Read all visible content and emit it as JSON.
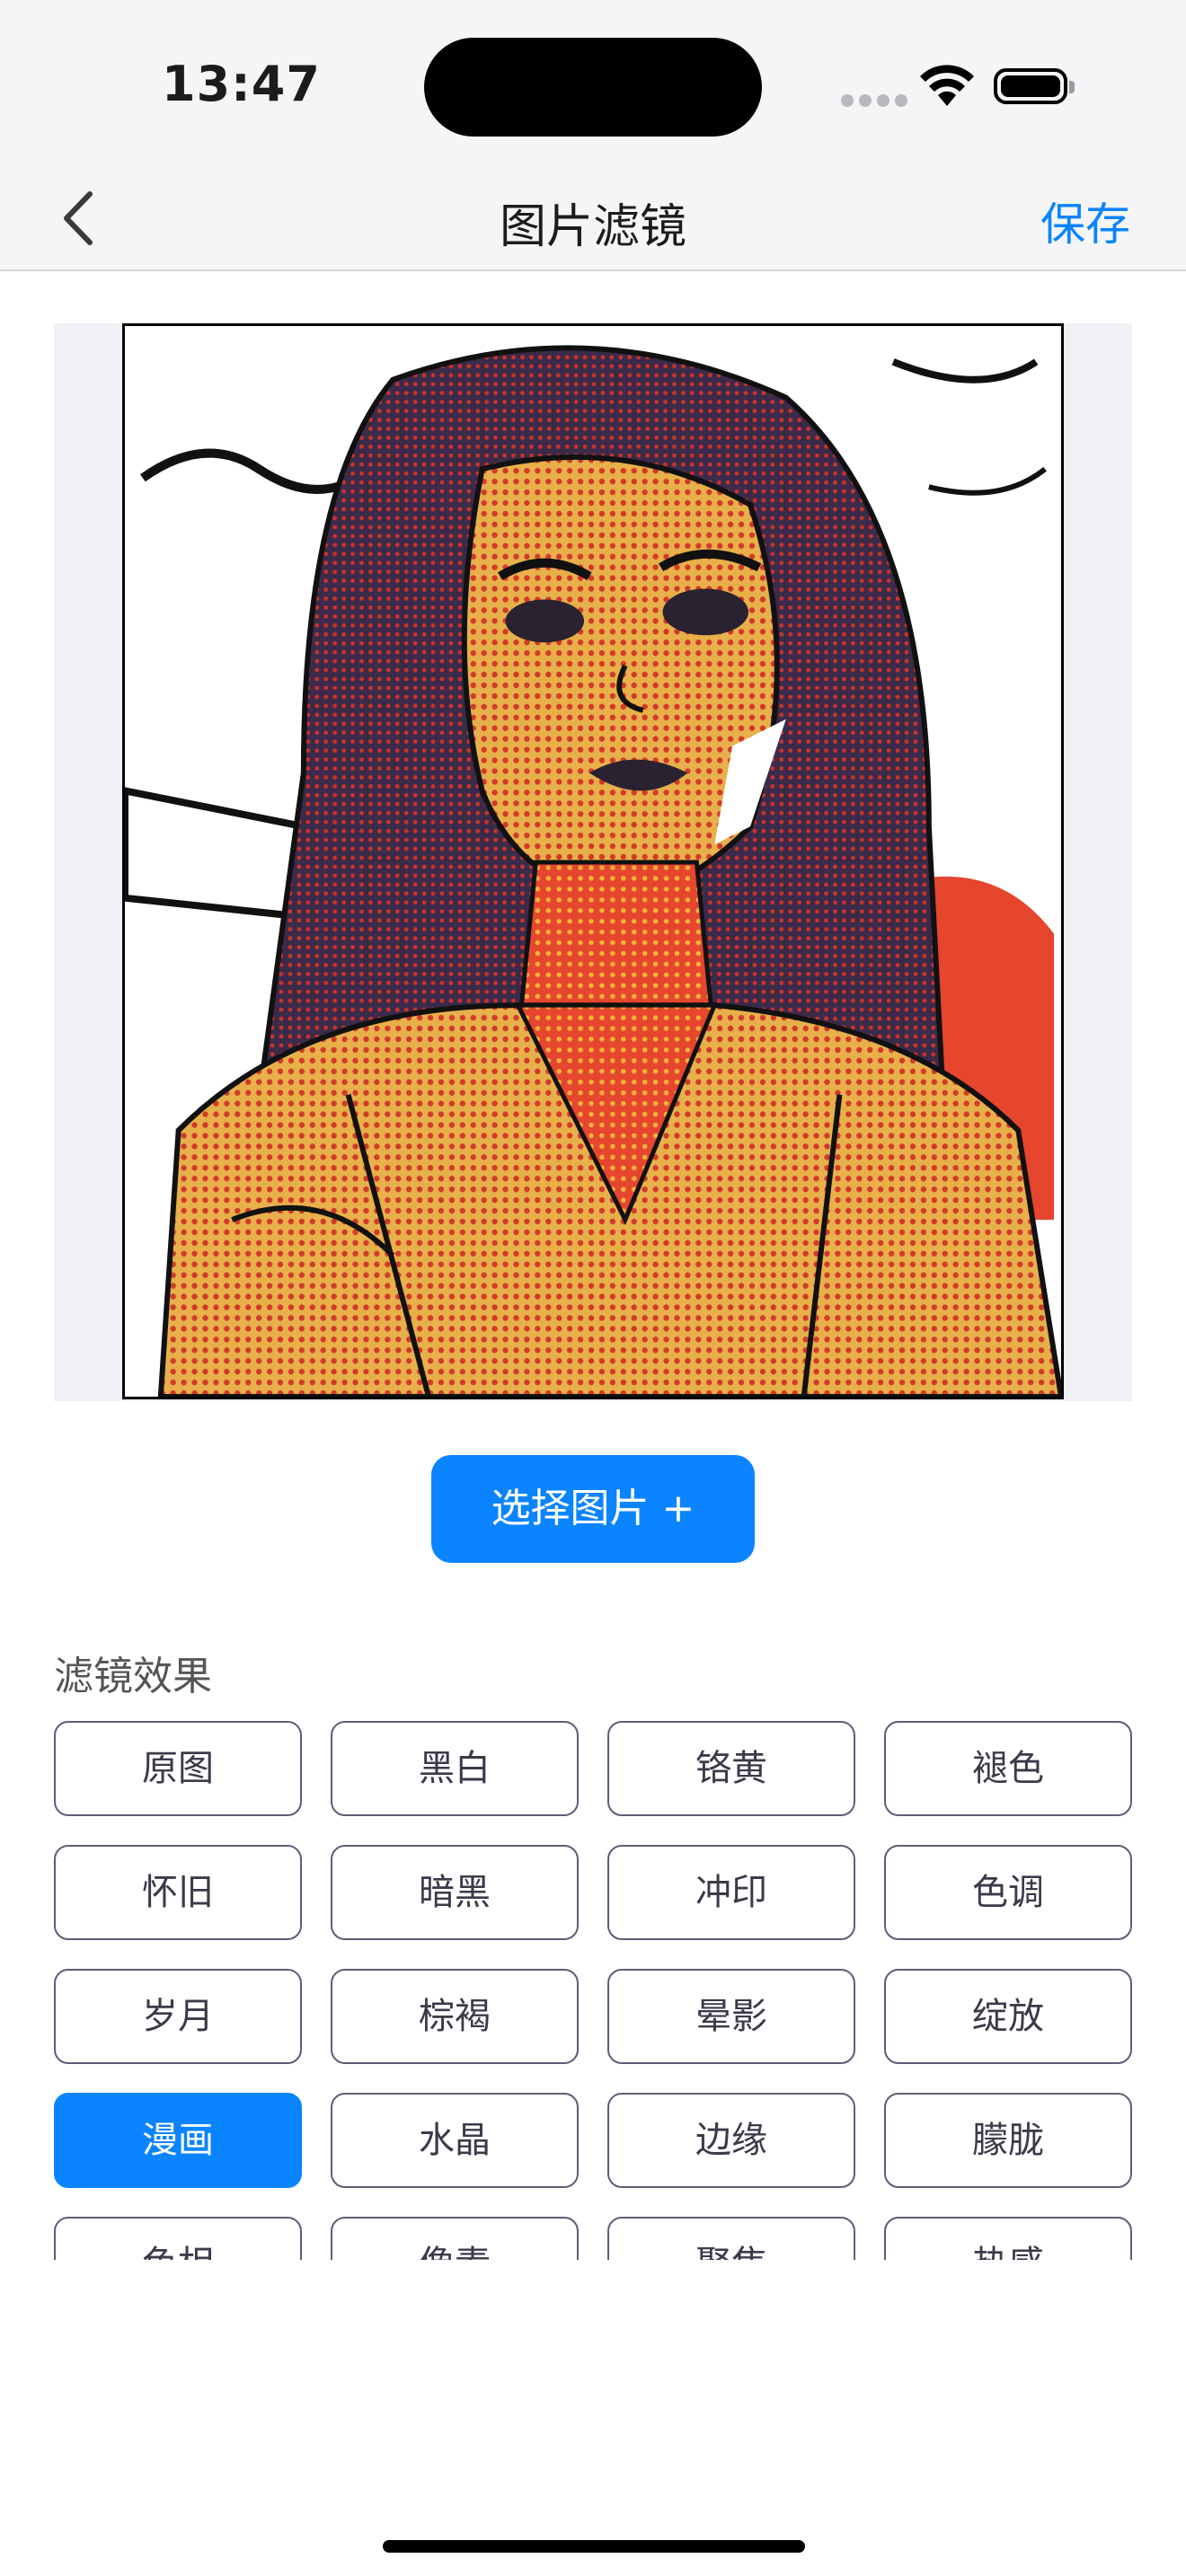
{
  "status": {
    "time": "13:47"
  },
  "nav": {
    "title": "图片滤镜",
    "save_label": "保存"
  },
  "preview": {
    "description_icon": "comic-filtered-portrait"
  },
  "actions": {
    "choose_image_label": "选择图片 +"
  },
  "filters": {
    "section_title": "滤镜效果",
    "selected": "漫画",
    "items": [
      "原图",
      "黑白",
      "铬黄",
      "褪色",
      "怀旧",
      "暗黑",
      "冲印",
      "色调",
      "岁月",
      "棕褐",
      "晕影",
      "绽放",
      "漫画",
      "水晶",
      "边缘",
      "朦胧",
      "色相",
      "像素",
      "聚焦",
      "热感"
    ]
  },
  "colors": {
    "accent": "#0a84ff",
    "button_border": "#5b5e78"
  }
}
